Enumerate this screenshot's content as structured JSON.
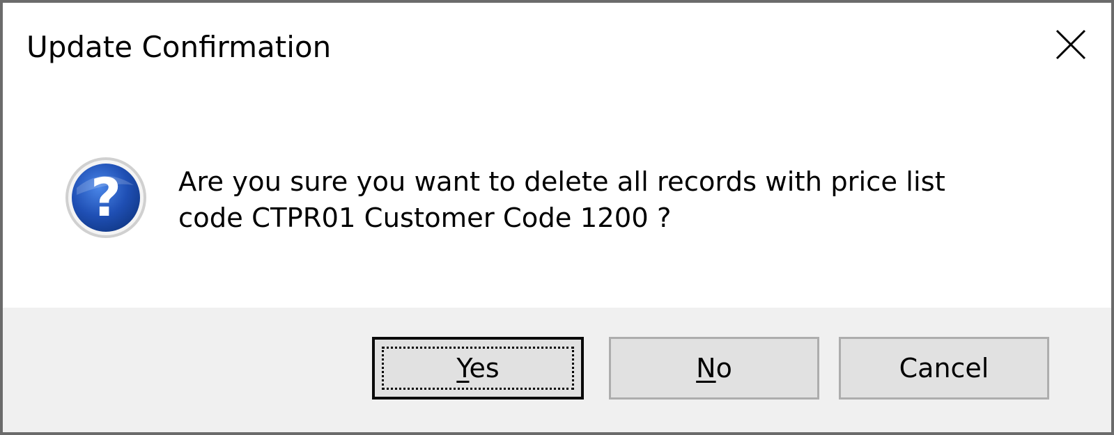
{
  "dialog": {
    "title": "Update Confirmation",
    "close_icon": "close-icon",
    "message_icon": "question-icon",
    "message": "Are you sure you want to delete all records with price list\ncode CTPR01 Customer Code 1200 ?",
    "buttons": {
      "yes": {
        "mnemonic": "Y",
        "rest": "es"
      },
      "no": {
        "mnemonic": "N",
        "rest": "o"
      },
      "cancel": {
        "label": "Cancel"
      }
    },
    "colors": {
      "footer_bg": "#f0f0f0",
      "button_bg": "#e1e1e1",
      "icon_blue": "#1f4fb4"
    }
  }
}
